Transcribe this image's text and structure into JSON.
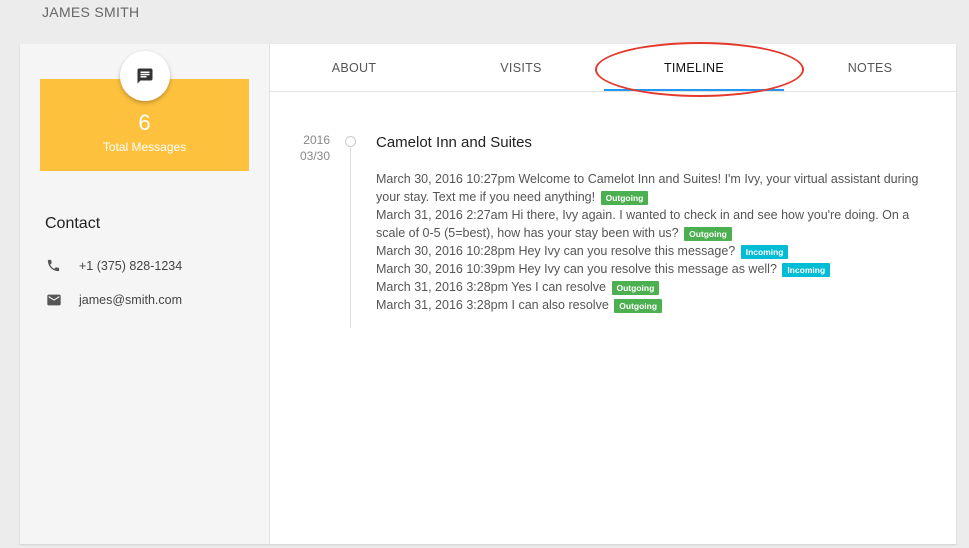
{
  "header": {
    "name": "JAMES SMITH"
  },
  "stats": {
    "count": "6",
    "label": "Total Messages",
    "icon": "message-icon",
    "color": "#fdc13e"
  },
  "contact": {
    "title": "Contact",
    "phone": "+1 (375) 828-1234",
    "email": "james@smith.com"
  },
  "tabs": [
    {
      "label": "ABOUT"
    },
    {
      "label": "VISITS"
    },
    {
      "label": "TIMELINE",
      "active": true
    },
    {
      "label": "NOTES"
    }
  ],
  "timeline": {
    "year": "2016",
    "date": "03/30",
    "title": "Camelot Inn and Suites",
    "messages": [
      {
        "text": "March 30, 2016 10:27pm Welcome to Camelot Inn and Suites! I'm Ivy, your virtual assistant during your stay. Text me if you need anything!",
        "badge": "Outgoing"
      },
      {
        "text": "March 31, 2016 2:27am Hi there, Ivy again. I wanted to check in and see how you're doing. On a scale of 0-5 (5=best), how has your stay been with us?",
        "badge": "Outgoing"
      },
      {
        "text": "March 30, 2016 10:28pm Hey Ivy can you resolve this message?",
        "badge": "Incoming"
      },
      {
        "text": "March 30, 2016 10:39pm Hey Ivy can you resolve this message as well?",
        "badge": "Incoming"
      },
      {
        "text": "March 31, 2016 3:28pm Yes I can resolve",
        "badge": "Outgoing"
      },
      {
        "text": "March 31, 2016 3:28pm I can also resolve",
        "badge": "Outgoing"
      }
    ]
  },
  "colors": {
    "outgoing": "#4caf50",
    "incoming": "#00bcd4",
    "tab_indicator": "#2196f3",
    "highlight": "#e5392c"
  }
}
